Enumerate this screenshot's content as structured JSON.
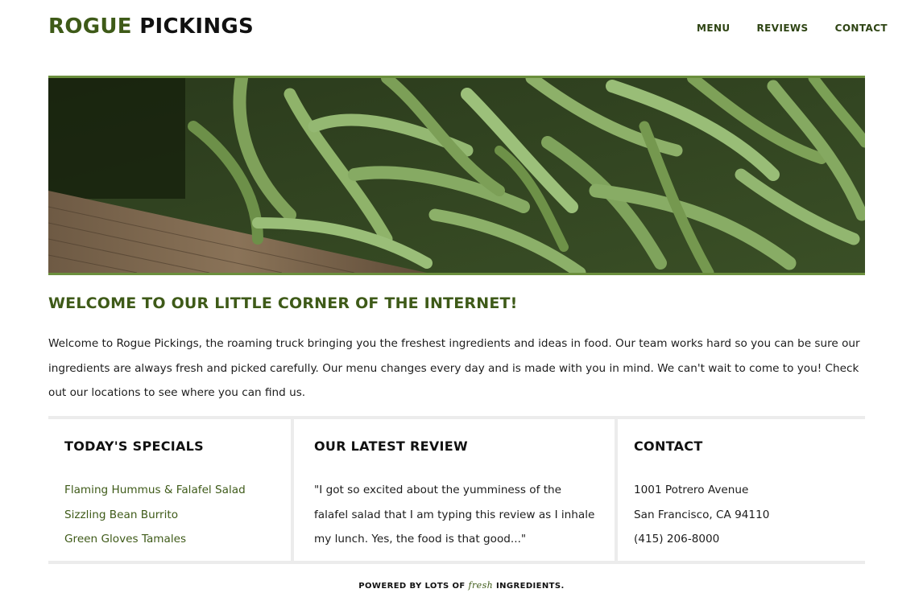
{
  "header": {
    "logo_first": "ROGUE",
    "logo_second": "PICKINGS",
    "nav": [
      {
        "label": "MENU"
      },
      {
        "label": "REVIEWS"
      },
      {
        "label": "CONTACT"
      }
    ]
  },
  "hero": {
    "image_subject": "green beans in a wooden crate"
  },
  "welcome": {
    "title": "WELCOME TO OUR LITTLE CORNER OF THE INTERNET!",
    "body": "Welcome to Rogue Pickings, the roaming truck bringing you the freshest ingredients and ideas in food. Our team works hard so you can be sure our ingredients are always fresh and picked carefully. Our menu changes every day and is made with you in mind. We can't wait to come to you! Check out our locations to see where you can find us."
  },
  "specials": {
    "title": "TODAY'S SPECIALS",
    "items": [
      "Flaming Hummus & Falafel Salad",
      "Sizzling Bean Burrito",
      "Green Gloves Tamales"
    ]
  },
  "review": {
    "title": "OUR LATEST REVIEW",
    "text": "\"I got so excited about the yumminess of the falafel salad that I am typing this review as I inhale my lunch. Yes, the food is that good...\""
  },
  "contact": {
    "title": "CONTACT",
    "lines": [
      "1001 Potrero Avenue",
      "San Francisco, CA 94110",
      "(415) 206-8000"
    ]
  },
  "footer": {
    "prefix": "POWERED BY LOTS OF",
    "emphasis": "fresh",
    "suffix": "INGREDIENTS."
  },
  "colors": {
    "brand_green": "#3e5a18",
    "divider_gray": "#ececec",
    "hero_border": "#6b8f3d"
  }
}
